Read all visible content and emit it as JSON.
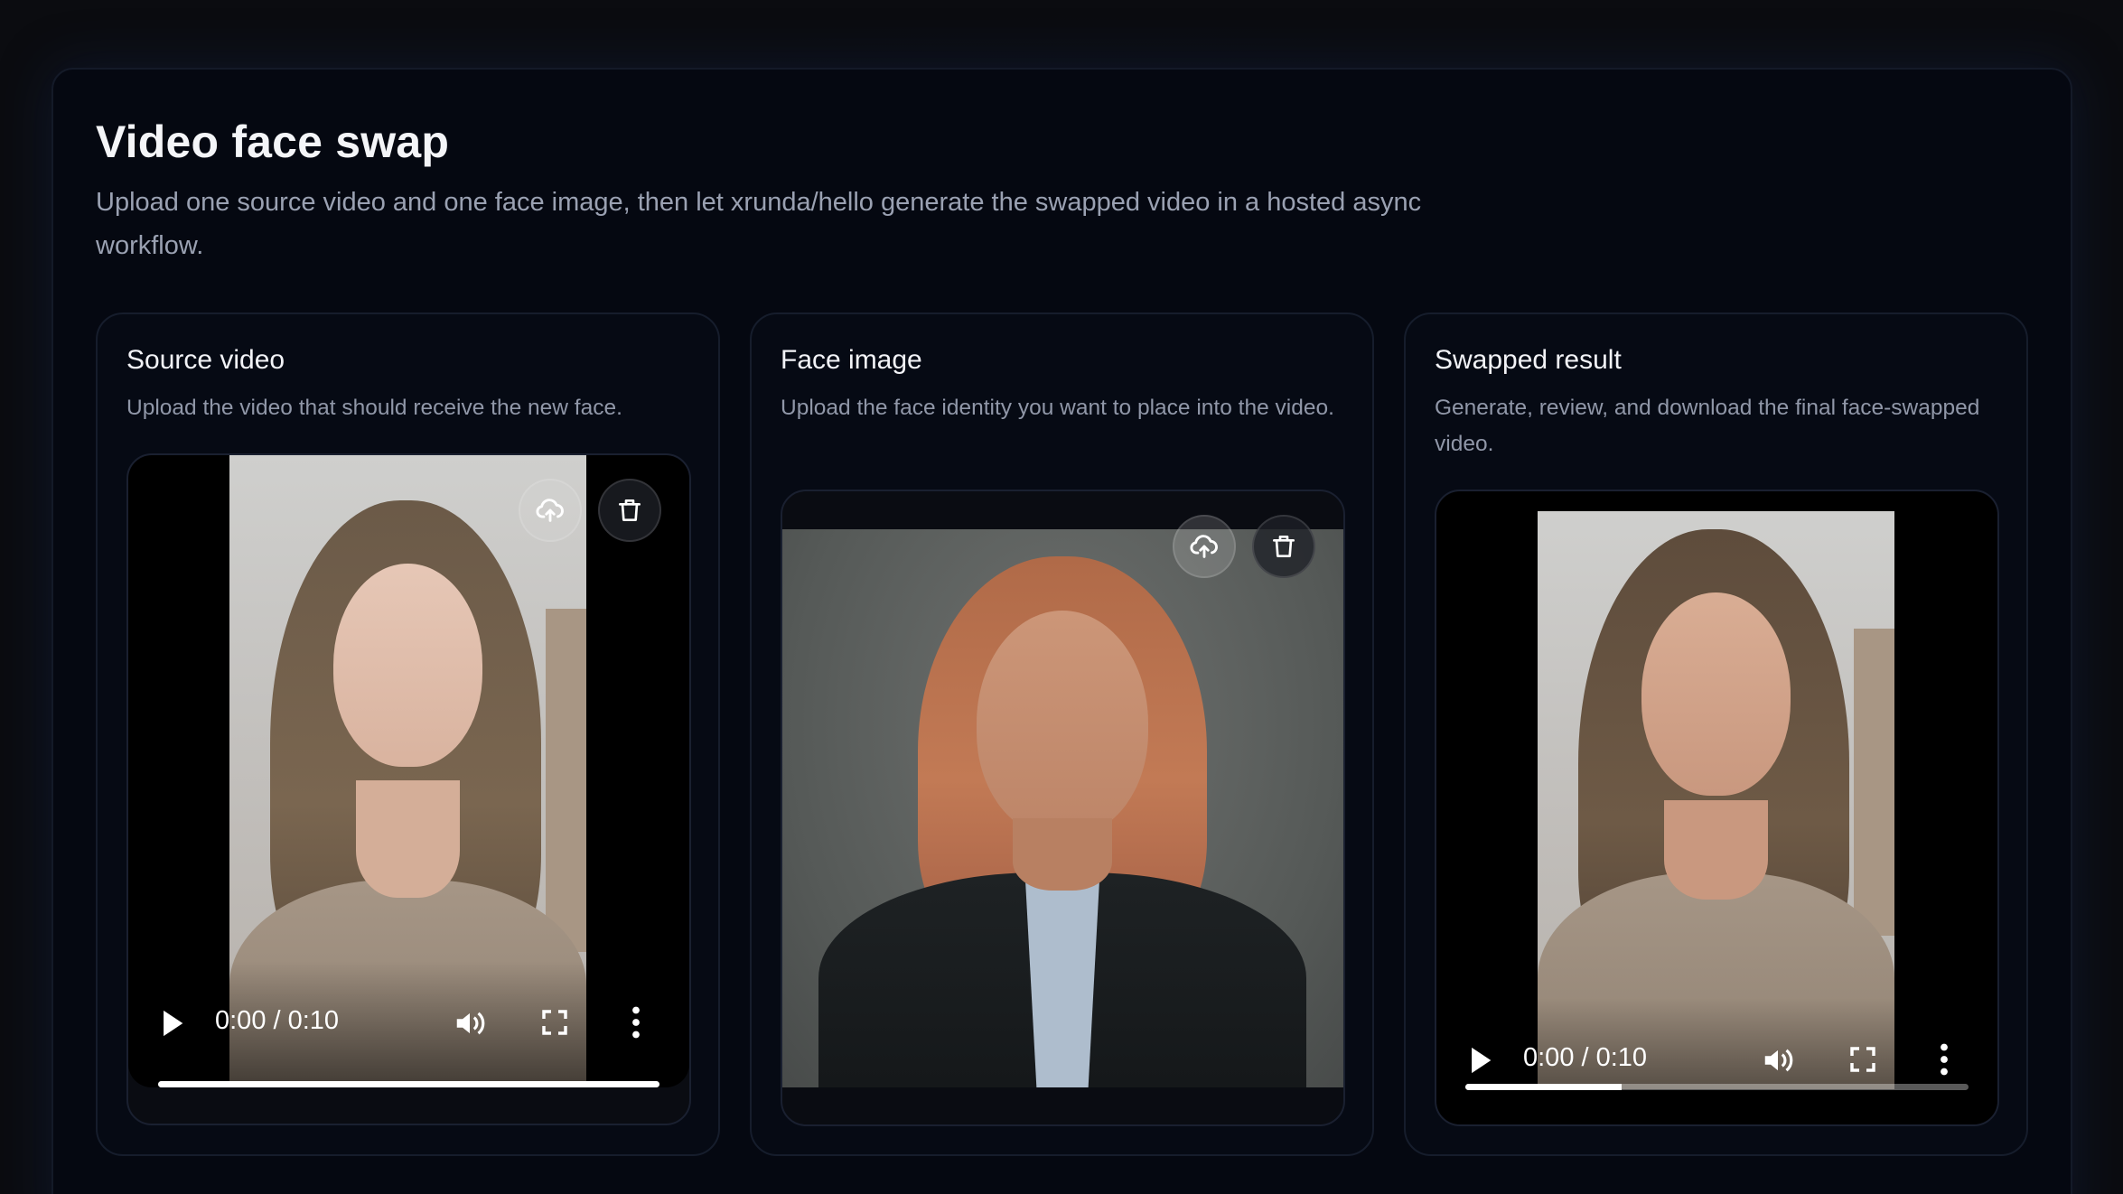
{
  "page": {
    "title": "Video face swap",
    "subtitle": "Upload one source video and one face image, then let xrunda/hello generate the swapped video in a hosted async workflow."
  },
  "cards": [
    {
      "title": "Source video",
      "description": "Upload the video that should receive the new face.",
      "player": {
        "time": "0:00 / 0:10",
        "progress": 1.0
      },
      "actions": [
        "upload-icon",
        "trash-icon"
      ]
    },
    {
      "title": "Face image",
      "description": "Upload the face identity you want to place into the video.",
      "actions": [
        "upload-icon",
        "trash-icon"
      ]
    },
    {
      "title": "Swapped result",
      "description": "Generate, review, and download the final face-swapped video.",
      "player": {
        "time": "0:00 / 0:10",
        "progress": 0.31
      }
    }
  ],
  "colors": {
    "background": "#0b0c10",
    "panel": "#050811",
    "card": "#060a14",
    "text_primary": "#f4f5f8",
    "text_secondary": "#9aa1b2"
  }
}
